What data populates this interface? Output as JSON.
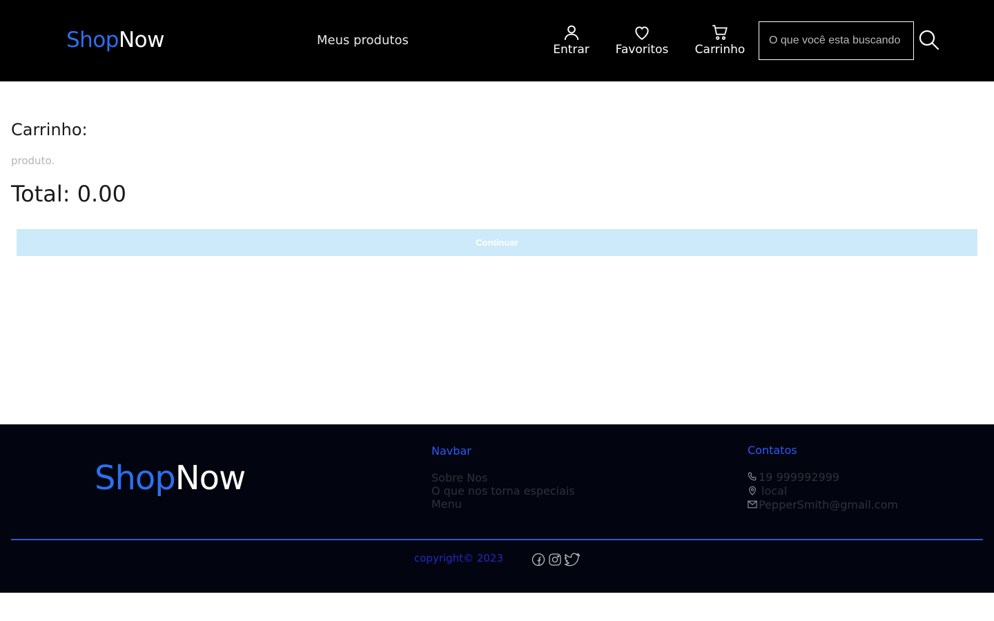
{
  "header": {
    "logo_part1": "Shop",
    "logo_part2": "Now",
    "nav_link": "Meus produtos",
    "login_label": "Entrar",
    "favorites_label": "Favoritos",
    "cart_label": "Carrinho",
    "search_placeholder": "O que você esta buscando"
  },
  "main": {
    "cart_title": "Carrinho:",
    "product_text": "produto.",
    "total_text": "Total: 0.00",
    "continue_label": "Continuar"
  },
  "footer": {
    "logo_part1": "Shop",
    "logo_part2": "Now",
    "navbar_heading": "Navbar",
    "navbar_links": [
      "Sobre Nos",
      "O que nos torna especiais",
      "Menu"
    ],
    "contacts_heading": "Contatos",
    "phone": "19 999992999",
    "location": "local",
    "email": "PepperSmith@gmail.com",
    "copyright": "copyright© 2023",
    "social_icons": [
      "facebook-icon",
      "instagram-icon",
      "twitter-icon"
    ]
  },
  "colors": {
    "brand_blue": "#2d6ff0",
    "header_bg": "#000000",
    "footer_bg": "#02050f",
    "continue_bg": "#cdeafa",
    "footer_accent": "#2b59ff"
  }
}
